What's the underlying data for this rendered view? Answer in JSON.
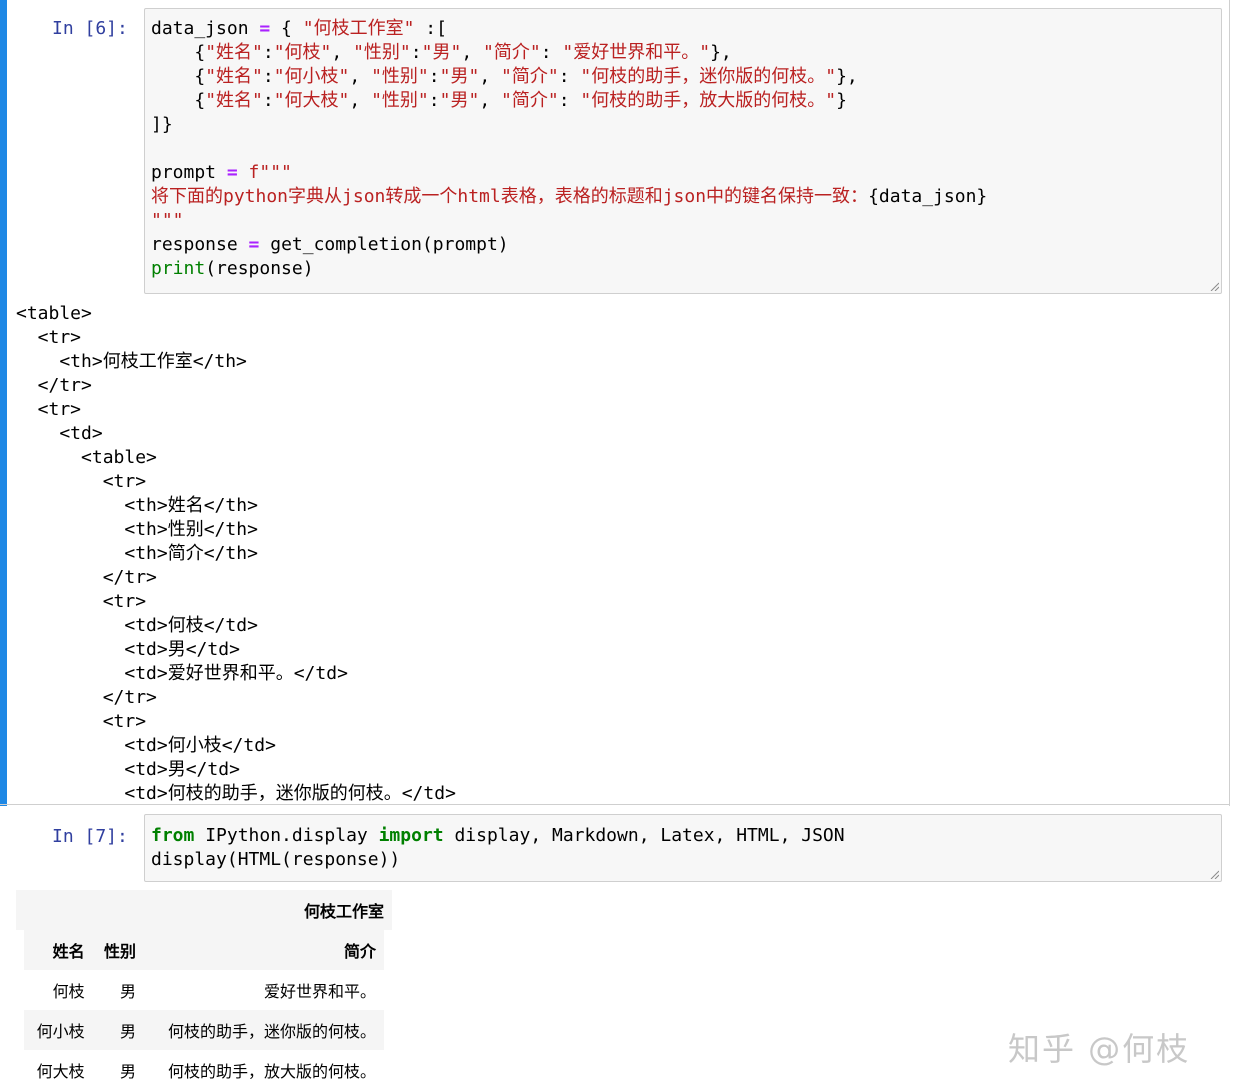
{
  "cells": [
    {
      "prompt": "In [6]:",
      "code": {
        "l1_a": "data_json ",
        "l1_op": "=",
        "l1_b": " { ",
        "l1_s1": "\"何枝工作室\"",
        "l1_c": " :[",
        "l2_a": "    {",
        "l2_s1": "\"姓名\"",
        "l2_c1": ":",
        "l2_s2": "\"何枝\"",
        "l2_c2": ", ",
        "l2_s3": "\"性别\"",
        "l2_c3": ":",
        "l2_s4": "\"男\"",
        "l2_c4": ", ",
        "l2_s5": "\"简介\"",
        "l2_c5": ": ",
        "l2_s6": "\"爱好世界和平。\"",
        "l2_c6": "},",
        "l3_a": "    {",
        "l3_s1": "\"姓名\"",
        "l3_c1": ":",
        "l3_s2": "\"何小枝\"",
        "l3_c2": ", ",
        "l3_s3": "\"性别\"",
        "l3_c3": ":",
        "l3_s4": "\"男\"",
        "l3_c4": ", ",
        "l3_s5": "\"简介\"",
        "l3_c5": ": ",
        "l3_s6": "\"何枝的助手，迷你版的何枝。\"",
        "l3_c6": "},",
        "l4_a": "    {",
        "l4_s1": "\"姓名\"",
        "l4_c1": ":",
        "l4_s2": "\"何大枝\"",
        "l4_c2": ", ",
        "l4_s3": "\"性别\"",
        "l4_c3": ":",
        "l4_s4": "\"男\"",
        "l4_c4": ", ",
        "l4_s5": "\"简介\"",
        "l4_c5": ": ",
        "l4_s6": "\"何枝的助手，放大版的何枝。\"",
        "l4_c6": "}",
        "l5": "]}",
        "l7_a": "prompt ",
        "l7_op": "=",
        "l7_s": " f\"\"\"",
        "l8_s1": "将下面的python字典从json转成一个html表格，表格的标题和json中的键名保持一致：",
        "l8_b": "{data_json}",
        "l9_s": "\"\"\"",
        "l10_a": "response ",
        "l10_op": "=",
        "l10_b": " get_completion(prompt)",
        "l11_bi": "print",
        "l11_b": "(response)"
      },
      "output_lines": [
        "<table>",
        "  <tr>",
        "    <th>何枝工作室</th>",
        "  </tr>",
        "  <tr>",
        "    <td>",
        "      <table>",
        "        <tr>",
        "          <th>姓名</th>",
        "          <th>性别</th>",
        "          <th>简介</th>",
        "        </tr>",
        "        <tr>",
        "          <td>何枝</td>",
        "          <td>男</td>",
        "          <td>爱好世界和平。</td>",
        "        </tr>",
        "        <tr>",
        "          <td>何小枝</td>",
        "          <td>男</td>",
        "          <td>何枝的助手，迷你版的何枝。</td>"
      ]
    },
    {
      "prompt": "In [7]:",
      "code": {
        "l1_k1": "from",
        "l1_a": " IPython.display ",
        "l1_k2": "import",
        "l1_b": " display, Markdown, Latex, HTML, JSON",
        "l2": "display(HTML(response))"
      },
      "rendered_table": {
        "title": "何枝工作室",
        "headers": [
          "姓名",
          "性别",
          "简介"
        ],
        "rows": [
          [
            "何枝",
            "男",
            "爱好世界和平。"
          ],
          [
            "何小枝",
            "男",
            "何枝的助手，迷你版的何枝。"
          ],
          [
            "何大枝",
            "男",
            "何枝的助手，放大版的何枝。"
          ]
        ]
      }
    }
  ],
  "watermark": "知乎 @何枝",
  "colors": {
    "selected_sidebar": "#1e88e5",
    "prompt": "#303f9f",
    "keyword": "#008000",
    "string": "#ba2121",
    "operator": "#aa22ff"
  }
}
